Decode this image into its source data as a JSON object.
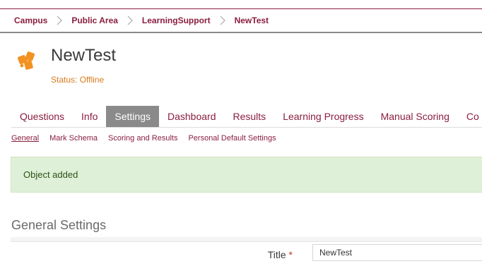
{
  "breadcrumb": {
    "items": [
      "Campus",
      "Public Area",
      "LearningSupport",
      "NewTest"
    ],
    "separator_icon": "chevron-right-icon"
  },
  "header": {
    "icon": "puzzle-icon",
    "title": "NewTest",
    "status": "Status: Offline"
  },
  "tabs": {
    "items": [
      "Questions",
      "Info",
      "Settings",
      "Dashboard",
      "Results",
      "Learning Progress",
      "Manual Scoring",
      "Co"
    ],
    "active": "Settings"
  },
  "subtabs": {
    "items": [
      "General",
      "Mark Schema",
      "Scoring and Results",
      "Personal Default Settings"
    ],
    "active": "General"
  },
  "alert": {
    "message": "Object added"
  },
  "section": {
    "title": "General Settings"
  },
  "form": {
    "title_label": "Title",
    "required_mark": "*",
    "title_value": "NewTest"
  },
  "colors": {
    "accent": "#8a1e3f",
    "status_orange": "#d97a1a",
    "icon_orange": "#f29222",
    "alert_bg": "#dff0d8",
    "active_tab": "#8a8a8a"
  }
}
